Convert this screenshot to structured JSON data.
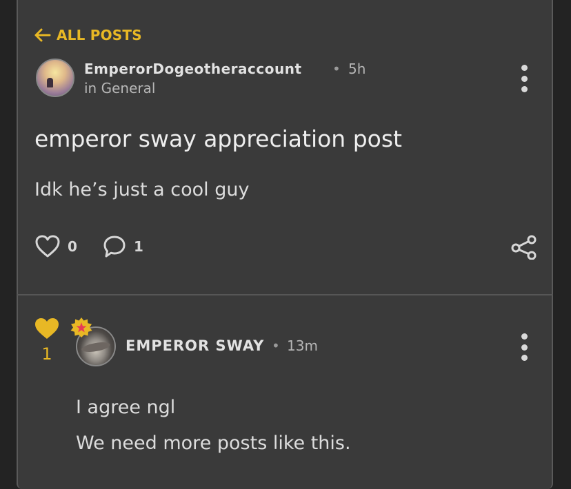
{
  "nav": {
    "back_label": "ALL POSTS"
  },
  "post": {
    "author": "EmperorDogeotheraccount",
    "separator": "•",
    "time": "5h",
    "category": "in General",
    "title": "emperor sway appreciation post",
    "body": "Idk he’s just a cool guy",
    "likes": "0",
    "comments": "1"
  },
  "comment": {
    "likes": "1",
    "author": "EMPEROR SWAY",
    "separator": "•",
    "time": "13m",
    "lines": [
      "I agree ngl",
      "We need more posts like this."
    ]
  },
  "colors": {
    "accent": "#e8b825",
    "card": "#3a3a3a",
    "background": "#232323",
    "badge_star": "#e83a55"
  },
  "icons": [
    "arrow-left-icon",
    "more-vertical-icon",
    "heart-outline-icon",
    "comment-bubble-icon",
    "share-icon",
    "heart-filled-icon",
    "star-badge-icon"
  ]
}
